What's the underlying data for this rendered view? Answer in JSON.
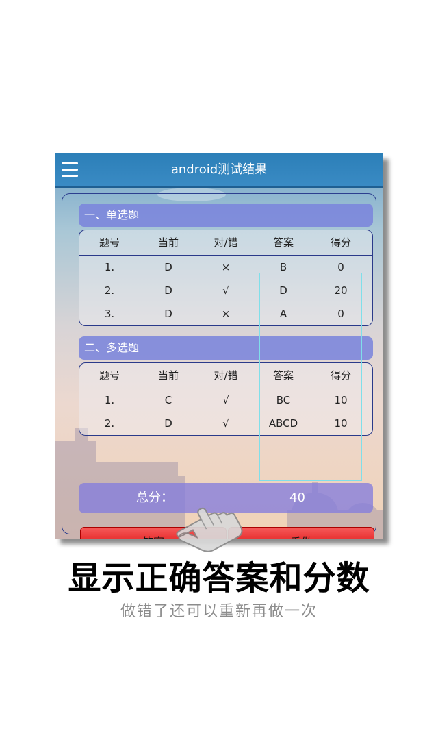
{
  "app": {
    "title": "android测试结果"
  },
  "single_choice": {
    "header": "一、单选题",
    "columns": [
      "题号",
      "当前",
      "对/错",
      "答案",
      "得分"
    ],
    "rows": [
      [
        "1.",
        "D",
        "×",
        "B",
        "0"
      ],
      [
        "2.",
        "D",
        "√",
        "D",
        "20"
      ],
      [
        "3.",
        "D",
        "×",
        "A",
        "0"
      ]
    ]
  },
  "multi_choice": {
    "header": "二、多选题",
    "columns": [
      "题号",
      "当前",
      "对/错",
      "答案",
      "得分"
    ],
    "rows": [
      [
        "1.",
        "C",
        "√",
        "BC",
        "10"
      ],
      [
        "2.",
        "D",
        "√",
        "ABCD",
        "10"
      ]
    ]
  },
  "total": {
    "label": "总分：",
    "value": "40"
  },
  "buttons": {
    "answer": "答案",
    "redo": "重做"
  },
  "caption": {
    "headline": "显示正确答案和分数",
    "subline": "做错了还可以重新再做一次"
  },
  "icons": {
    "menu": "menu-icon",
    "pointer": "hand-pointer-icon"
  },
  "colors": {
    "appbar": "#2c7fb8",
    "section": "#7b85dc",
    "button": "#e32121",
    "highlight": "#7fdfea"
  }
}
